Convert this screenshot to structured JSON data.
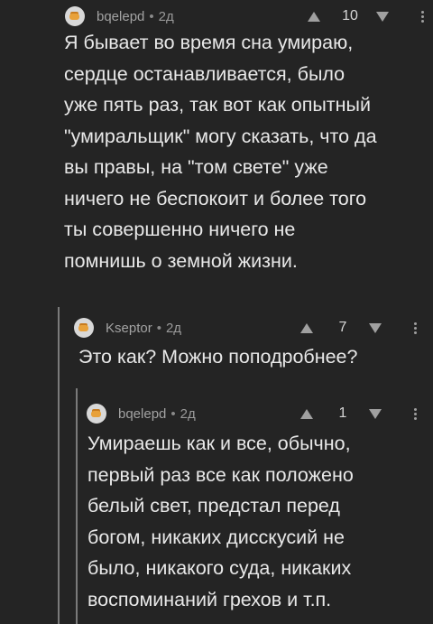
{
  "comments": [
    {
      "author": "bqelepd",
      "time": "2д",
      "rating": "10",
      "text": "Я бывает во время сна умираю,\nсердце останавливается, было\nуже пять раз, так вот как опытный\n\"умиральщик\" могу сказать, что да\nвы правы, на \"том свете\" уже\nничего не беспокоит и более того\nты совершенно ничего не\nпомнишь о земной жизни."
    },
    {
      "author": "Kseptor",
      "time": "2д",
      "rating": "7",
      "text": "Это как? Можно поподробнее?"
    },
    {
      "author": "bqelepd",
      "time": "2д",
      "rating": "1",
      "text": "Умираешь как и все, обычно,\nпервый раз все как положено\nбелый свет, предстал перед\nбогом, никаких дисскусий не\nбыло, никакого суда, никаких\nвоспоминаний грехов и т.п."
    }
  ],
  "separator": "•"
}
